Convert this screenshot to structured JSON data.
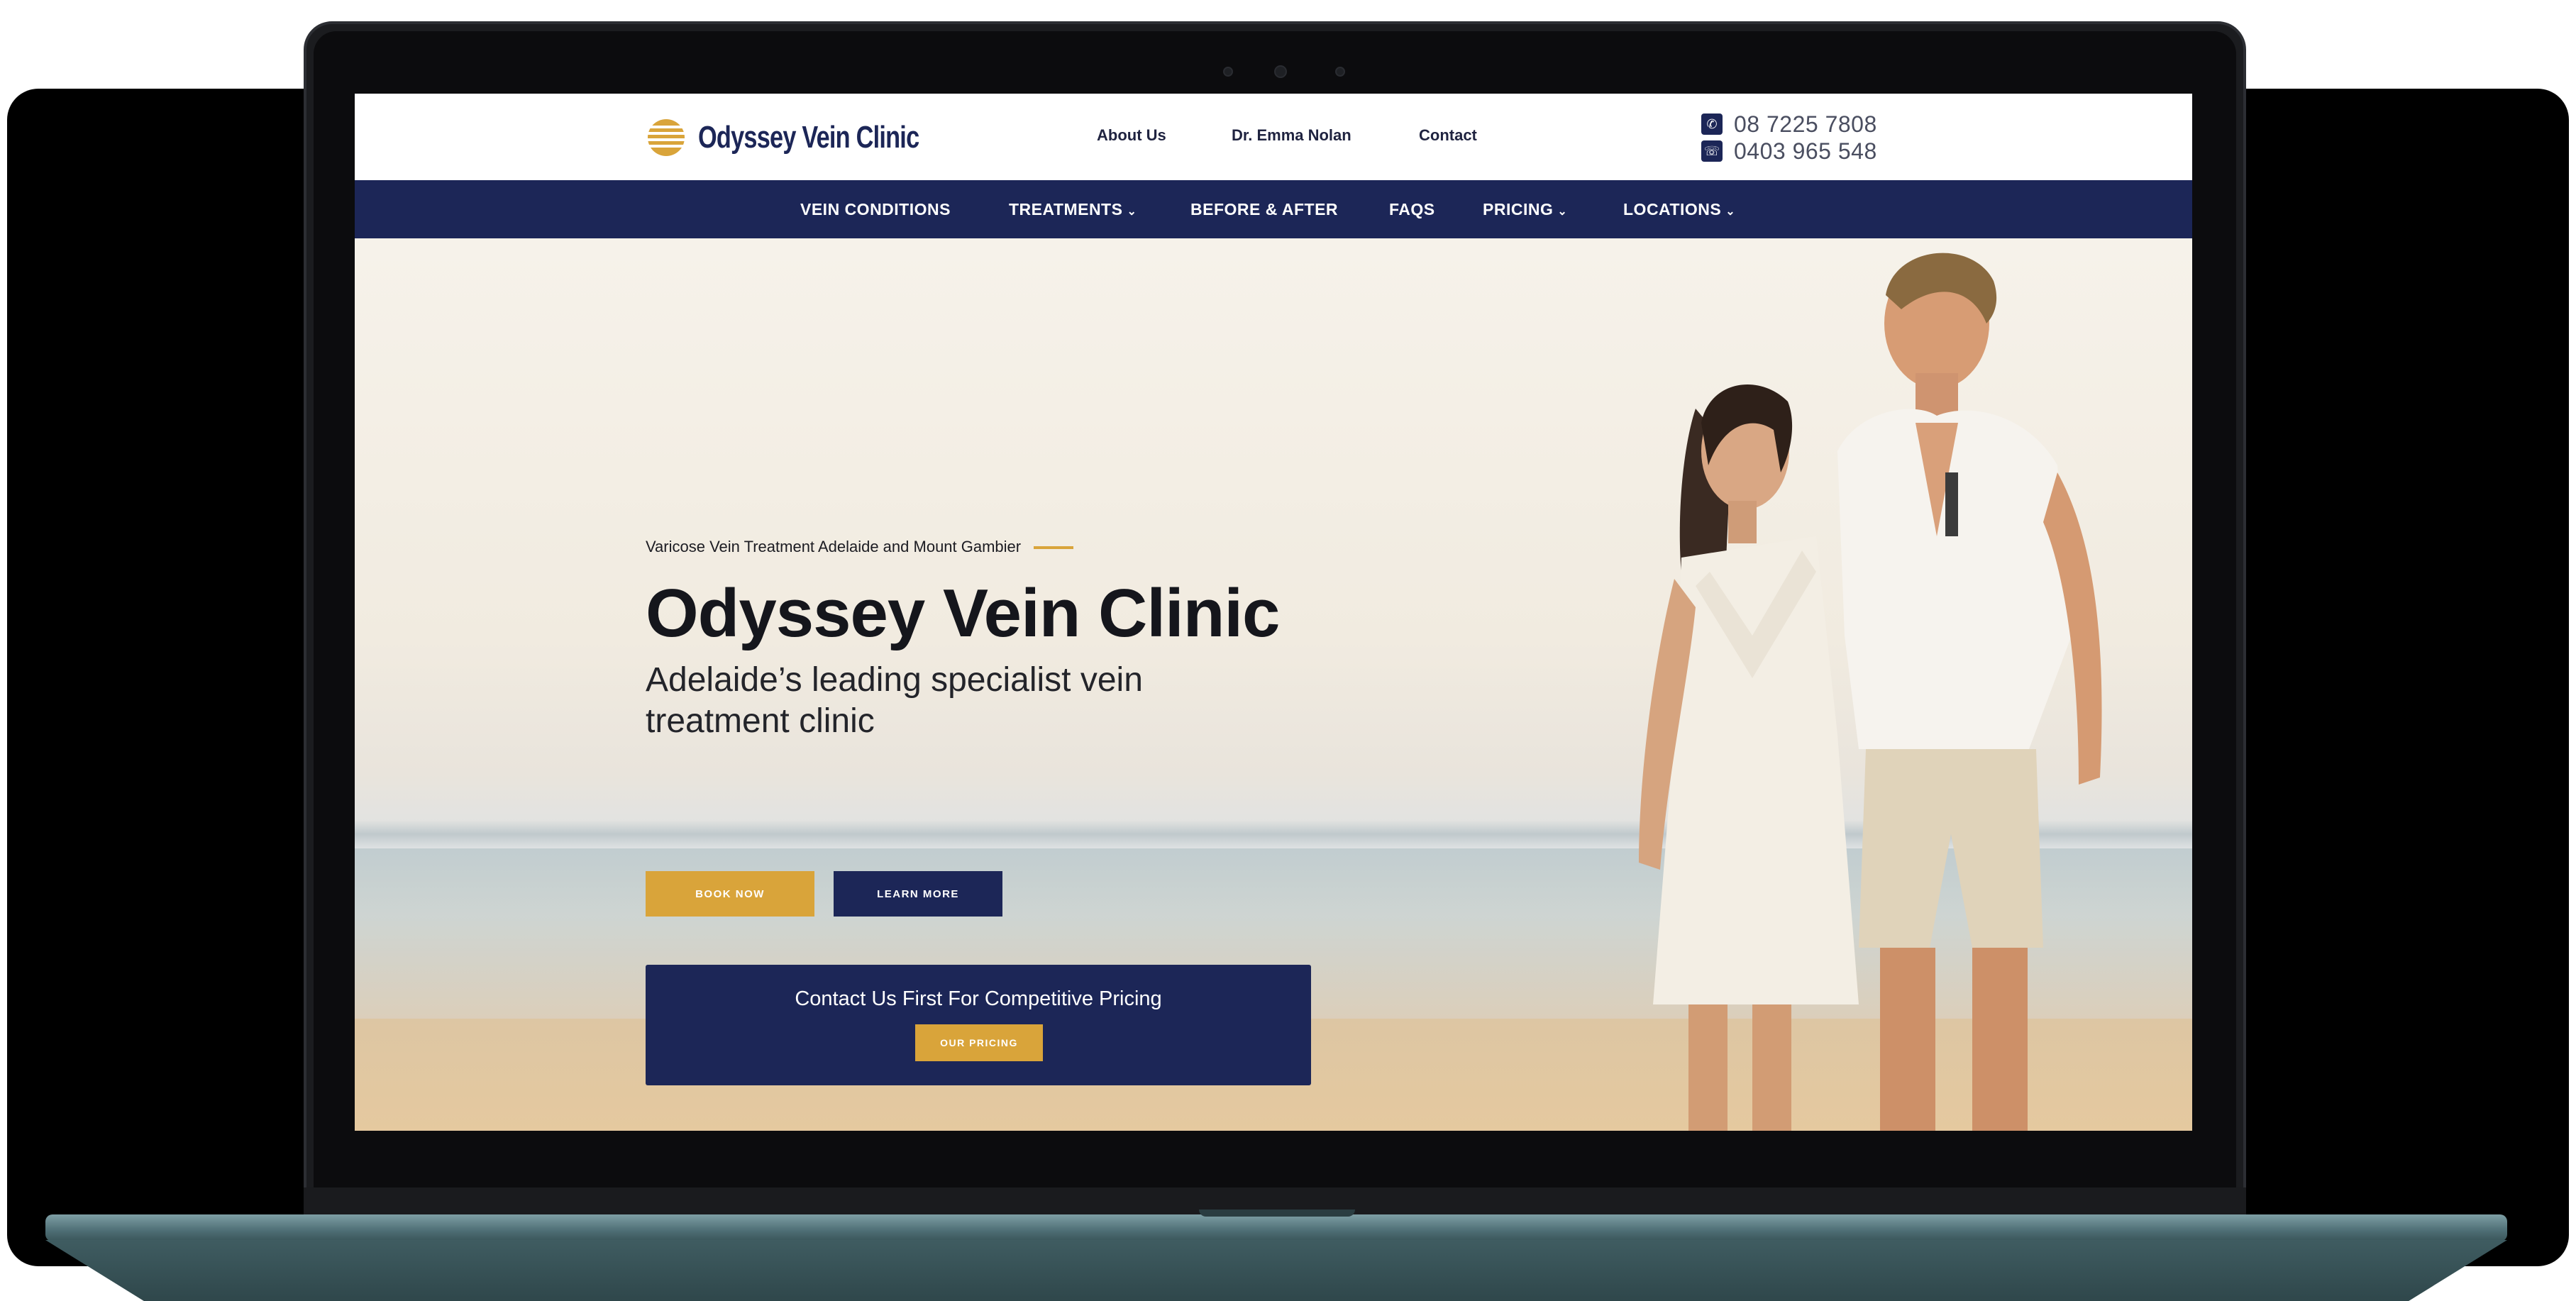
{
  "header": {
    "logo_text": "Odyssey Vein Clinic",
    "links": [
      "About Us",
      "Dr. Emma Nolan",
      "Contact"
    ],
    "phones": [
      "08 7225 7808",
      "0403 965 548"
    ]
  },
  "nav": {
    "items": [
      {
        "label": "VEIN CONDITIONS",
        "chevron": ""
      },
      {
        "label": "TREATMENTS",
        "chevron": "⌄"
      },
      {
        "label": "BEFORE & AFTER",
        "chevron": ""
      },
      {
        "label": "FAQS",
        "chevron": ""
      },
      {
        "label": "PRICING",
        "chevron": "⌄"
      },
      {
        "label": "LOCATIONS",
        "chevron": "⌄"
      }
    ]
  },
  "hero": {
    "eyebrow": "Varicose Vein Treatment Adelaide and Mount Gambier",
    "title": "Odyssey Vein Clinic",
    "subtitle": "Adelaide’s leading specialist vein treatment clinic",
    "book_label": "BOOK NOW",
    "learn_label": "LEARN MORE"
  },
  "promo": {
    "text": "Contact Us First For Competitive Pricing",
    "button_label": "OUR PRICING"
  },
  "colors": {
    "navy": "#1c2657",
    "gold": "#d9a43a"
  }
}
